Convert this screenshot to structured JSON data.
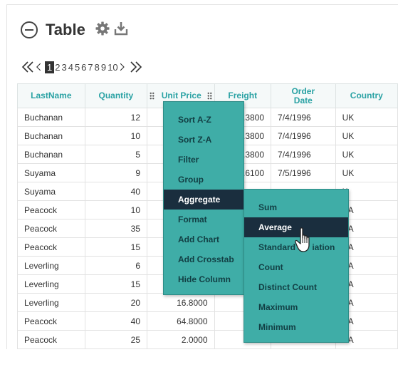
{
  "header": {
    "title": "Table",
    "settings_icon": "gear-icon",
    "download_icon": "download-icon",
    "collapse_icon": "minus-circle-icon"
  },
  "pager": {
    "first_icon": "double-chevron-left-icon",
    "prev_icon": "chevron-left-icon",
    "next_icon": "chevron-right-icon",
    "last_icon": "double-chevron-right-icon",
    "pages": [
      "1",
      "2",
      "3",
      "4",
      "5",
      "6",
      "7",
      "8",
      "9",
      "10"
    ],
    "active_page": "1"
  },
  "table": {
    "columns": [
      {
        "label": "LastName"
      },
      {
        "label": "Quantity"
      },
      {
        "label": "Unit Price"
      },
      {
        "label": "Freight"
      },
      {
        "label": "Order Date"
      },
      {
        "label": "Country"
      }
    ],
    "rows": [
      [
        "Buchanan",
        "12",
        "",
        ".3800",
        "7/4/1996",
        "UK"
      ],
      [
        "Buchanan",
        "10",
        "",
        ".3800",
        "7/4/1996",
        "UK"
      ],
      [
        "Buchanan",
        "5",
        "",
        ".3800",
        "7/4/1996",
        "UK"
      ],
      [
        "Suyama",
        "9",
        "",
        ".6100",
        "7/5/1996",
        "UK"
      ],
      [
        "Suyama",
        "40",
        "",
        "",
        "",
        "K"
      ],
      [
        "Peacock",
        "10",
        "",
        "",
        "",
        "SA"
      ],
      [
        "Peacock",
        "35",
        "",
        "",
        "",
        "SA"
      ],
      [
        "Peacock",
        "15",
        "",
        "",
        "",
        "SA"
      ],
      [
        "Leverling",
        "6",
        "",
        "",
        "",
        "SA"
      ],
      [
        "Leverling",
        "15",
        "",
        "",
        "",
        "SA"
      ],
      [
        "Leverling",
        "20",
        "16.8000",
        "41",
        "",
        "SA"
      ],
      [
        "Peacock",
        "40",
        "64.8000",
        "51",
        "",
        "SA"
      ],
      [
        "Peacock",
        "25",
        "2.0000",
        "51",
        "",
        "SA"
      ]
    ]
  },
  "column_menu": {
    "items": [
      "Sort A-Z",
      "Sort Z-A",
      "Filter",
      "Group",
      "Aggregate",
      "Format",
      "Add Chart",
      "Add Crosstab",
      "Hide Column"
    ],
    "active": "Aggregate"
  },
  "aggregate_menu": {
    "items": [
      "Sum",
      "Average",
      "Standard Deviation",
      "Count",
      "Distinct Count",
      "Maximum",
      "Minimum"
    ],
    "visible_labels": [
      "Sum",
      "Average",
      "Standard ",
      "iation",
      "Count",
      "Distinct Count",
      "Maximum",
      "Minimum"
    ],
    "active": "Average"
  },
  "cursor_icon": "hand-pointer-icon",
  "colors": {
    "header_text": "#2aa2a4",
    "menu_bg": "#3fada7",
    "menu_text": "#123f44",
    "menu_active_bg": "#1a2e3e",
    "menu_active_text": "#ffffff"
  }
}
